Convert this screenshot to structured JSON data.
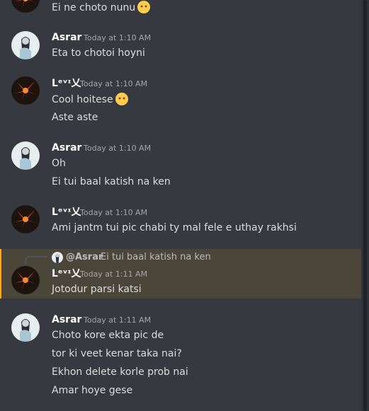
{
  "users": {
    "asrar": "Asrar",
    "levix": "ᒪᵉᵛᶦ乂"
  },
  "messages": [
    {
      "text": "Ei ne choto nunu",
      "emoji": "no-mouth-face-icon"
    },
    {
      "author": "Asrar",
      "time": "Today at 1:10 AM",
      "lines": [
        "Eta to chotoi hoyni"
      ]
    },
    {
      "author": "ᒪᵉᵛᶦ乂",
      "time": "Today at 1:10 AM",
      "lines": [
        "Cool hoitese",
        "Aste aste"
      ]
    },
    {
      "author": "Asrar",
      "time": "Today at 1:10 AM",
      "lines": [
        "Oh",
        "Ei tui baal katish na ken"
      ]
    },
    {
      "author": "ᒪᵉᵛᶦ乂",
      "time": "Today at 1:10 AM",
      "lines": [
        "Ami jantm tui pic chabi ty mal fele e uthay rakhsi"
      ]
    },
    {
      "author": "ᒪᵉᵛᶦ乂",
      "time": "Today at 1:11 AM",
      "lines": [
        "Jotodur parsi katsi"
      ],
      "reply": {
        "mention": "@Asrar",
        "text": "Ei tui baal katish na ken"
      }
    },
    {
      "author": "Asrar",
      "time": "Today at 1:11 AM",
      "lines": [
        "Choto kore ekta pic de",
        "tor ki veet kenar taka nai?",
        "Ekhon delete korle prob nai",
        "Amar hoye gese"
      ]
    }
  ]
}
